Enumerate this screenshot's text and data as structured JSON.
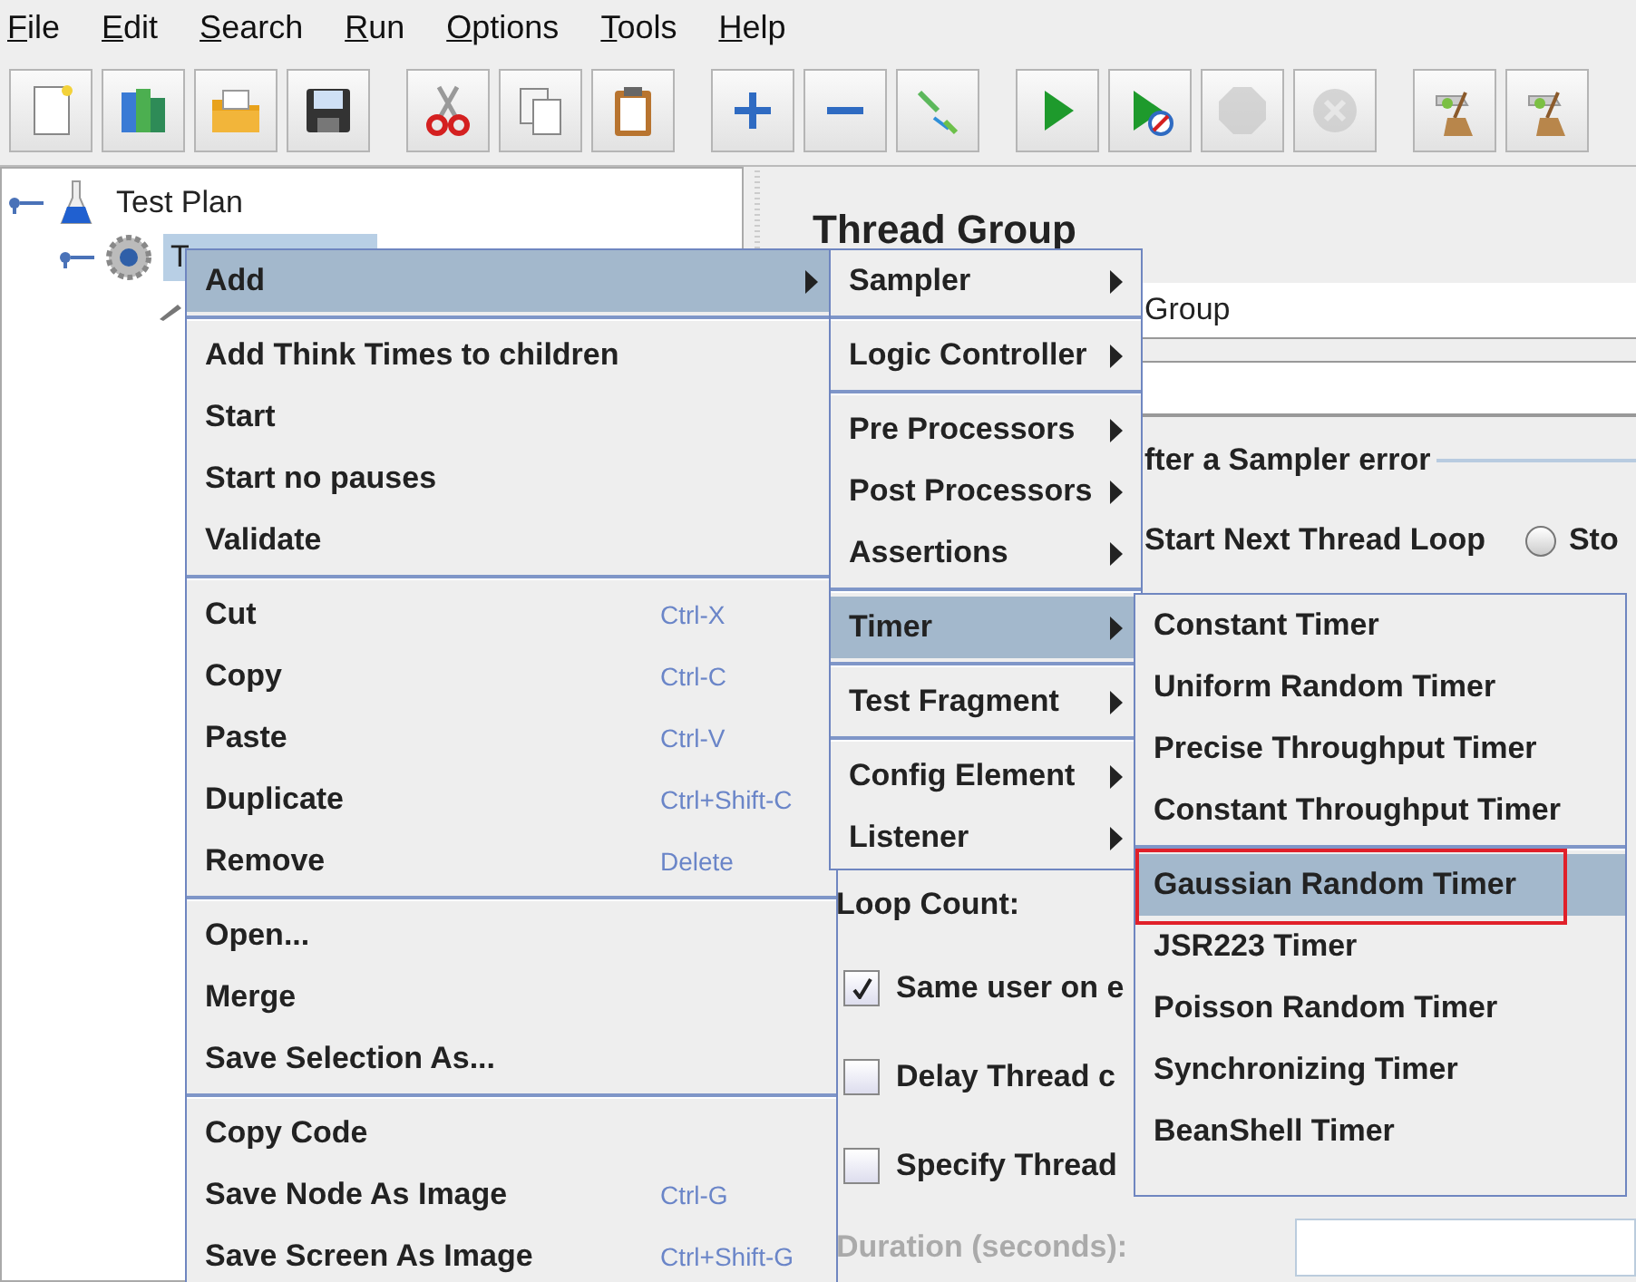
{
  "menubar": [
    "File",
    "Edit",
    "Search",
    "Run",
    "Options",
    "Tools",
    "Help"
  ],
  "toolbar": [
    {
      "kind": "new",
      "disabled": false
    },
    {
      "kind": "templates",
      "disabled": false
    },
    {
      "kind": "open",
      "disabled": false
    },
    {
      "kind": "save",
      "disabled": false
    },
    {
      "kind": "separator"
    },
    {
      "kind": "cut",
      "disabled": false
    },
    {
      "kind": "copy",
      "disabled": false
    },
    {
      "kind": "paste",
      "disabled": false
    },
    {
      "kind": "separator"
    },
    {
      "kind": "expand",
      "disabled": false
    },
    {
      "kind": "collapse",
      "disabled": false
    },
    {
      "kind": "toggle",
      "disabled": false
    },
    {
      "kind": "separator"
    },
    {
      "kind": "start",
      "disabled": false
    },
    {
      "kind": "start-no-pause",
      "disabled": false
    },
    {
      "kind": "stop",
      "disabled": true
    },
    {
      "kind": "shutdown",
      "disabled": true
    },
    {
      "kind": "separator"
    },
    {
      "kind": "clear",
      "disabled": false
    },
    {
      "kind": "clear-all",
      "disabled": false
    }
  ],
  "tree": [
    {
      "label": "Test Plan",
      "kind": "plan",
      "selected": false,
      "children": [
        {
          "label": "T",
          "kind": "thread-group",
          "selected": true,
          "children": [
            {
              "kind": "sampler"
            }
          ]
        }
      ]
    }
  ],
  "panel": {
    "title": "Thread Group",
    "name_value": "Group",
    "error_section": "fter a Sampler error",
    "next_loop_option": "Start Next Thread Loop",
    "radio": {
      "label": "Sto",
      "selected": false
    },
    "loop_count_label": "Loop Count:",
    "checkboxes": [
      {
        "label": "Same user on e",
        "checked": true
      },
      {
        "label": "Delay Thread c",
        "checked": false
      },
      {
        "label": "Specify Thread",
        "checked": false
      }
    ],
    "duration": {
      "label": "Duration (seconds):",
      "disabled": true
    }
  },
  "menus": [
    {
      "items": [
        {
          "kind": "item",
          "label": "Add",
          "submenu": true,
          "selected": true
        },
        {
          "kind": "separator"
        },
        {
          "kind": "item",
          "label": "Add Think Times to children",
          "selected": false
        },
        {
          "kind": "item",
          "label": "Start",
          "selected": false
        },
        {
          "kind": "item",
          "label": "Start no pauses",
          "selected": false
        },
        {
          "kind": "item",
          "label": "Validate",
          "selected": false
        },
        {
          "kind": "separator"
        },
        {
          "kind": "item",
          "label": "Cut",
          "shortcut": "Ctrl-X",
          "selected": false
        },
        {
          "kind": "item",
          "label": "Copy",
          "shortcut": "Ctrl-C",
          "selected": false
        },
        {
          "kind": "item",
          "label": "Paste",
          "shortcut": "Ctrl-V",
          "selected": false
        },
        {
          "kind": "item",
          "label": "Duplicate",
          "shortcut": "Ctrl+Shift-C",
          "selected": false
        },
        {
          "kind": "item",
          "label": "Remove",
          "shortcut": "Delete",
          "selected": false
        },
        {
          "kind": "separator"
        },
        {
          "kind": "item",
          "label": "Open...",
          "selected": false
        },
        {
          "kind": "item",
          "label": "Merge",
          "selected": false
        },
        {
          "kind": "item",
          "label": "Save Selection As...",
          "selected": false
        },
        {
          "kind": "separator"
        },
        {
          "kind": "item",
          "label": "Copy Code",
          "selected": false
        },
        {
          "kind": "item",
          "label": "Save Node As Image",
          "shortcut": "Ctrl-G",
          "selected": false
        },
        {
          "kind": "item",
          "label": "Save Screen As Image",
          "shortcut": "Ctrl+Shift-G",
          "selected": false
        }
      ]
    },
    {
      "items": [
        {
          "kind": "item",
          "label": "Sampler",
          "submenu": true,
          "selected": false
        },
        {
          "kind": "separator"
        },
        {
          "kind": "item",
          "label": "Logic Controller",
          "submenu": true,
          "selected": false
        },
        {
          "kind": "separator"
        },
        {
          "kind": "item",
          "label": "Pre Processors",
          "submenu": true,
          "selected": false
        },
        {
          "kind": "item",
          "label": "Post Processors",
          "submenu": true,
          "selected": false
        },
        {
          "kind": "item",
          "label": "Assertions",
          "submenu": true,
          "selected": false
        },
        {
          "kind": "separator"
        },
        {
          "kind": "item",
          "label": "Timer",
          "submenu": true,
          "selected": true
        },
        {
          "kind": "separator"
        },
        {
          "kind": "item",
          "label": "Test Fragment",
          "submenu": true,
          "selected": false
        },
        {
          "kind": "separator"
        },
        {
          "kind": "item",
          "label": "Config Element",
          "submenu": true,
          "selected": false
        },
        {
          "kind": "item",
          "label": "Listener",
          "submenu": true,
          "selected": false
        }
      ]
    },
    {
      "items": [
        {
          "kind": "item",
          "label": "Constant Timer",
          "selected": false
        },
        {
          "kind": "item",
          "label": "Uniform Random Timer",
          "selected": false
        },
        {
          "kind": "item",
          "label": "Precise Throughput Timer",
          "selected": false
        },
        {
          "kind": "item",
          "label": "Constant Throughput Timer",
          "selected": false
        },
        {
          "kind": "separator"
        },
        {
          "kind": "item",
          "label": "Gaussian Random Timer",
          "selected": true,
          "outlined": true
        },
        {
          "kind": "item",
          "label": "JSR223 Timer",
          "selected": false
        },
        {
          "kind": "item",
          "label": "Poisson Random Timer",
          "selected": false
        },
        {
          "kind": "item",
          "label": "Synchronizing Timer",
          "selected": false
        },
        {
          "kind": "item",
          "label": "BeanShell Timer",
          "selected": false
        }
      ]
    }
  ]
}
